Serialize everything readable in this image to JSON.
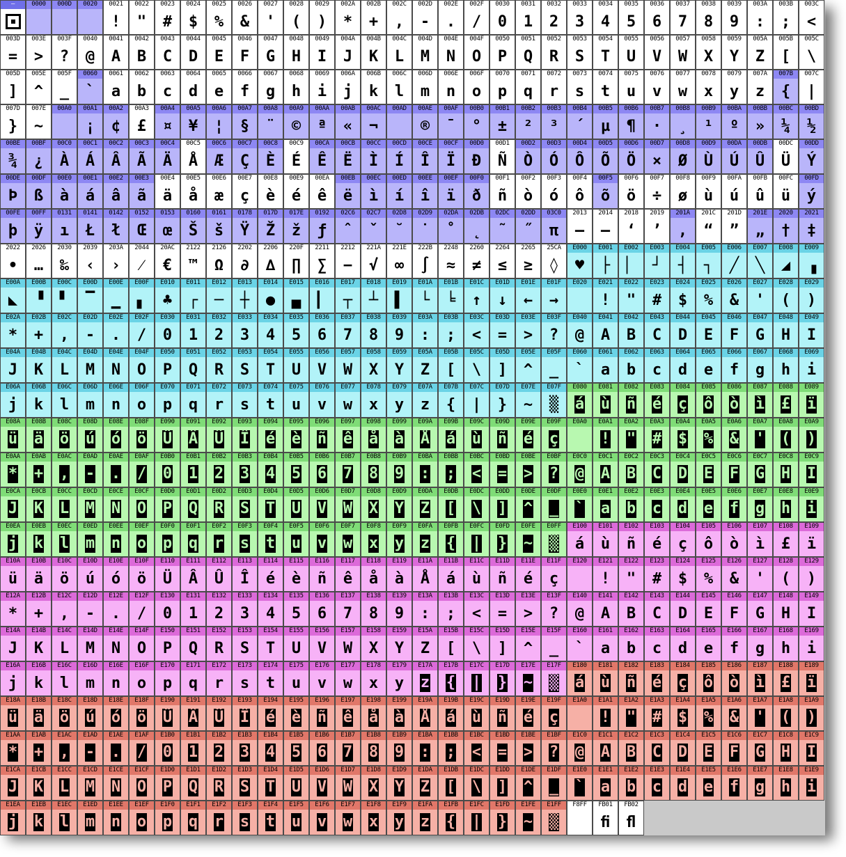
{
  "colors": {
    "basic": [
      "#ffffff",
      "#ffffff"
    ],
    "latin": [
      "#b9b5fa",
      "#8d87f3"
    ],
    "cyan": [
      "#b2f3f8",
      "#6ad3e6"
    ],
    "green": [
      "#b8f8b0",
      "#7fdc77"
    ],
    "magenta": [
      "#f7b2f7",
      "#dc6ad9"
    ],
    "salmon": [
      "#f6b0a6",
      "#e17769"
    ],
    "special_white": [
      "#ffffff",
      "#ffffff"
    ]
  },
  "codes": [
    "—",
    "0000",
    "000D",
    "0020",
    "0021",
    "0022",
    "0023",
    "0024",
    "0025",
    "0026",
    "0027",
    "0028",
    "0029",
    "002A",
    "002B",
    "002C",
    "002D",
    "002E",
    "002F",
    "0030",
    "0031",
    "0032",
    "0033",
    "0034",
    "0035",
    "0036",
    "0037",
    "0038",
    "0039",
    "003A",
    "003B",
    "003C",
    "003D",
    "003E",
    "003F",
    "0040",
    "0041",
    "0042",
    "0043",
    "0044",
    "0045",
    "0046",
    "0047",
    "0048",
    "0049",
    "004A",
    "004B",
    "004C",
    "004D",
    "004E",
    "004F",
    "0050",
    "0051",
    "0052",
    "0053",
    "0054",
    "0055",
    "0056",
    "0057",
    "0058",
    "0059",
    "005A",
    "005B",
    "005C",
    "005D",
    "005E",
    "005F",
    "0060",
    "0061",
    "0062",
    "0063",
    "0064",
    "0065",
    "0066",
    "0067",
    "0068",
    "0069",
    "006A",
    "006B",
    "006C",
    "006D",
    "006E",
    "006F",
    "0070",
    "0071",
    "0072",
    "0073",
    "0074",
    "0075",
    "0076",
    "0077",
    "0078",
    "0079",
    "007A",
    "007B",
    "007C",
    "007D",
    "007E",
    "00A0",
    "00A1",
    "00A2",
    "00A3",
    "00A4",
    "00A5",
    "00A6",
    "00A7",
    "00A8",
    "00A9",
    "00AA",
    "00AB",
    "00AC",
    "00AD",
    "00AE",
    "00AF",
    "00B0",
    "00B1",
    "00B2",
    "00B3",
    "00B4",
    "00B5",
    "00B6",
    "00B7",
    "00B8",
    "00B9",
    "00BA",
    "00BB",
    "00BC",
    "00BD",
    "00BE",
    "00BF",
    "00C0",
    "00C1",
    "00C2",
    "00C3",
    "00C4",
    "00C5",
    "00C6",
    "00C7",
    "00C8",
    "00C9",
    "00CA",
    "00CB",
    "00CC",
    "00CD",
    "00CE",
    "00CF",
    "00D0",
    "00D1",
    "00D2",
    "00D3",
    "00D4",
    "00D5",
    "00D6",
    "00D7",
    "00D8",
    "00D9",
    "00DA",
    "00DB",
    "00DC",
    "00DD",
    "00DE",
    "00DF",
    "00E0",
    "00E1",
    "00E2",
    "00E3",
    "00E4",
    "00E5",
    "00E6",
    "00E7",
    "00E8",
    "00E9",
    "00EA",
    "00EB",
    "00EC",
    "00ED",
    "00EE",
    "00EF",
    "00F0",
    "00F1",
    "00F2",
    "00F3",
    "00F4",
    "00F5",
    "00F6",
    "00F7",
    "00F8",
    "00F9",
    "00FA",
    "00FB",
    "00FC",
    "00FD",
    "00FE",
    "00FF",
    "0131",
    "0141",
    "0142",
    "0152",
    "0153",
    "0160",
    "0161",
    "0178",
    "017D",
    "017E",
    "0192",
    "02C6",
    "02C7",
    "02D8",
    "02D9",
    "02DA",
    "02DB",
    "02DC",
    "02DD",
    "03C0",
    "2013",
    "2014",
    "2018",
    "2019",
    "201A",
    "201C",
    "201D",
    "201E",
    "2020",
    "2021",
    "2022",
    "2026",
    "2030",
    "2039",
    "203A",
    "2044",
    "20AC",
    "2122",
    "2126",
    "2202",
    "2206",
    "220F",
    "2211",
    "2212",
    "221A",
    "221E",
    "222B",
    "2248",
    "2260",
    "2264",
    "2265",
    "25CA",
    "E000",
    "E001",
    "E002",
    "E003",
    "E004",
    "E005",
    "E006",
    "E007",
    "E008",
    "E009",
    "E00A",
    "E00B",
    "E00C",
    "E00D",
    "E00E",
    "E00F",
    "E010",
    "E011",
    "E012",
    "E013",
    "E014",
    "E015",
    "E016",
    "E017",
    "E018",
    "E019",
    "E01A",
    "E01B",
    "E01C",
    "E01D",
    "E01E",
    "E01F",
    "E020",
    "E021",
    "E022",
    "E023",
    "E024",
    "E025",
    "E026",
    "E027",
    "E028",
    "E029",
    "E02A",
    "E02B",
    "E02C",
    "E02D",
    "E02E",
    "E02F",
    "E030",
    "E031",
    "E032",
    "E033",
    "E034",
    "E035",
    "E036",
    "E037",
    "E038",
    "E039",
    "E03A",
    "E03B",
    "E03C",
    "E03D",
    "E03E",
    "E03F",
    "E040",
    "E041",
    "E042",
    "E043",
    "E044",
    "E045",
    "E046",
    "E047",
    "E048",
    "E049",
    "E04A",
    "E04B",
    "E04C",
    "E04D",
    "E04E",
    "E04F",
    "E050",
    "E051",
    "E052",
    "E053",
    "E054",
    "E055",
    "E056",
    "E057",
    "E058",
    "E059",
    "E05A",
    "E05B",
    "E05C",
    "E05D",
    "E05E",
    "E05F",
    "E060",
    "E061",
    "E062",
    "E063",
    "E064",
    "E065",
    "E066",
    "E067",
    "E068",
    "E069",
    "E06A",
    "E06B",
    "E06C",
    "E06D",
    "E06E",
    "E06F",
    "E070",
    "E071",
    "E072",
    "E073",
    "E074",
    "E075",
    "E076",
    "E077",
    "E078",
    "E079",
    "E07A",
    "E07B",
    "E07C",
    "E07D",
    "E07E",
    "E07F",
    "E080",
    "E081",
    "E082",
    "E083",
    "E084",
    "E085",
    "E086",
    "E087",
    "E088",
    "E089",
    "E08A",
    "E08B",
    "E08C",
    "E08D",
    "E08E",
    "E08F",
    "E090",
    "E091",
    "E092",
    "E093",
    "E094",
    "E095",
    "E096",
    "E097",
    "E098",
    "E099",
    "E09A",
    "E09B",
    "E09C",
    "E09D",
    "E09E",
    "E09F",
    "E0A0",
    "E0A1",
    "E0A2",
    "E0A3",
    "E0A4",
    "E0A5",
    "E0A6",
    "E0A7",
    "E0A8",
    "E0A9",
    "E0AA",
    "E0AB",
    "E0AC",
    "E0AD",
    "E0AE",
    "E0AF",
    "E0B0",
    "E0B1",
    "E0B2",
    "E0B3",
    "E0B4",
    "E0B5",
    "E0B6",
    "E0B7",
    "E0B8",
    "E0B9",
    "E0BA",
    "E0BB",
    "E0BC",
    "E0BD",
    "E0BE",
    "E0BF",
    "E0C0",
    "E0C1",
    "E0C2",
    "E0C3",
    "E0C4",
    "E0C5",
    "E0C6",
    "E0C7",
    "E0C8",
    "E0C9",
    "E0CA",
    "E0CB",
    "E0CC",
    "E0CD",
    "E0CE",
    "E0CF",
    "E0D0",
    "E0D1",
    "E0D2",
    "E0D3",
    "E0D4",
    "E0D5",
    "E0D6",
    "E0D7",
    "E0D8",
    "E0D9",
    "E0DA",
    "E0DB",
    "E0DC",
    "E0DD",
    "E0DE",
    "E0DF",
    "E0E0",
    "E0E1",
    "E0E2",
    "E0E3",
    "E0E4",
    "E0E5",
    "E0E6",
    "E0E7",
    "E0E8",
    "E0E9",
    "E0EA",
    "E0EB",
    "E0EC",
    "E0ED",
    "E0EE",
    "E0EF",
    "E0F0",
    "E0F1",
    "E0F2",
    "E0F3",
    "E0F4",
    "E0F5",
    "E0F6",
    "E0F7",
    "E0F8",
    "E0F9",
    "E0FA",
    "E0FB",
    "E0FC",
    "E0FD",
    "E0FE",
    "E0FF",
    "E100",
    "E101",
    "E102",
    "E103",
    "E104",
    "E105",
    "E106",
    "E107",
    "E108",
    "E109",
    "E10A",
    "E10B",
    "E10C",
    "E10D",
    "E10E",
    "E10F",
    "E110",
    "E111",
    "E112",
    "E113",
    "E114",
    "E115",
    "E116",
    "E117",
    "E118",
    "E119",
    "E11A",
    "E11B",
    "E11C",
    "E11D",
    "E11E",
    "E11F",
    "E120",
    "E121",
    "E122",
    "E123",
    "E124",
    "E125",
    "E126",
    "E127",
    "E128",
    "E129",
    "E12A",
    "E12B",
    "E12C",
    "E12D",
    "E12E",
    "E12F",
    "E130",
    "E131",
    "E132",
    "E133",
    "E134",
    "E135",
    "E136",
    "E137",
    "E138",
    "E139",
    "E13A",
    "E13B",
    "E13C",
    "E13D",
    "E13E",
    "E13F",
    "E140",
    "E141",
    "E142",
    "E143",
    "E144",
    "E145",
    "E146",
    "E147",
    "E148",
    "E149",
    "E14A",
    "E14B",
    "E14C",
    "E14D",
    "E14E",
    "E14F",
    "E150",
    "E151",
    "E152",
    "E153",
    "E154",
    "E155",
    "E156",
    "E157",
    "E158",
    "E159",
    "E15A",
    "E15B",
    "E15C",
    "E15D",
    "E15E",
    "E15F",
    "E160",
    "E161",
    "E162",
    "E163",
    "E164",
    "E165",
    "E166",
    "E167",
    "E168",
    "E169",
    "E16A",
    "E16B",
    "E16C",
    "E16D",
    "E16E",
    "E16F",
    "E170",
    "E171",
    "E172",
    "E173",
    "E174",
    "E175",
    "E176",
    "E177",
    "E178",
    "E179",
    "E17A",
    "E17B",
    "E17C",
    "E17D",
    "E17E",
    "E17F",
    "E180",
    "E181",
    "E182",
    "E183",
    "E184",
    "E185",
    "E186",
    "E187",
    "E188",
    "E189",
    "E18A",
    "E18B",
    "E18C",
    "E18D",
    "E18E",
    "E18F",
    "E190",
    "E191",
    "E192",
    "E193",
    "E194",
    "E195",
    "E196",
    "E197",
    "E198",
    "E199",
    "E19A",
    "E19B",
    "E19C",
    "E19D",
    "E19E",
    "E19F",
    "E1A0",
    "E1A1",
    "E1A2",
    "E1A3",
    "E1A4",
    "E1A5",
    "E1A6",
    "E1A7",
    "E1A8",
    "E1A9",
    "E1AA",
    "E1AB",
    "E1AC",
    "E1AD",
    "E1AE",
    "E1AF",
    "E1B0",
    "E1B1",
    "E1B2",
    "E1B3",
    "E1B4",
    "E1B5",
    "E1B6",
    "E1B7",
    "E1B8",
    "E1B9",
    "E1BA",
    "E1BB",
    "E1BC",
    "E1BD",
    "E1BE",
    "E1BF",
    "E1C0",
    "E1C1",
    "E1C2",
    "E1C3",
    "E1C4",
    "E1C5",
    "E1C6",
    "E1C7",
    "E1C8",
    "E1C9",
    "E1CA",
    "E1CB",
    "E1CC",
    "E1CD",
    "E1CE",
    "E1CF",
    "E1D0",
    "E1D1",
    "E1D2",
    "E1D3",
    "E1D4",
    "E1D5",
    "E1D6",
    "E1D7",
    "E1D8",
    "E1D9",
    "E1DA",
    "E1DB",
    "E1DC",
    "E1DD",
    "E1DE",
    "E1DF",
    "E1E0",
    "E1E1",
    "E1E2",
    "E1E3",
    "E1E4",
    "E1E5",
    "E1E6",
    "E1E7",
    "E1E8",
    "E1E9",
    "E1EA",
    "E1EB",
    "E1EC",
    "E1ED",
    "E1EE",
    "E1EF",
    "E1F0",
    "E1F1",
    "E1F2",
    "E1F3",
    "E1F4",
    "E1F5",
    "E1F6",
    "E1F7",
    "E1F8",
    "E1F9",
    "E1FA",
    "E1FB",
    "E1FC",
    "E1FD",
    "E1FE",
    "E1FF",
    "F8FF",
    "FB01",
    "FB02"
  ],
  "glyphs": {
    "ascii": "!\"#$%&'()*+,-./0123456789:;<=>?@ABCDEFGHIJKLMNOPQRSTUVWXYZ[\\]^_`abcdefghijklmnopqrstuvwxyz{|}~",
    "latin1": [
      " ",
      "¡",
      "¢",
      "£",
      "¤",
      "¥",
      "¦",
      "§",
      "¨",
      "©",
      "ª",
      "«",
      "¬",
      "-",
      "®",
      "¯",
      "°",
      "±",
      "²",
      "³",
      "´",
      "µ",
      "¶",
      "·",
      "¸",
      "¹",
      "º",
      "»",
      "¼",
      "½",
      "¾",
      "¿",
      "À",
      "Á",
      "Â",
      "Ã",
      "Ä",
      "Å",
      "Æ",
      "Ç",
      "È",
      "É",
      "Ê",
      "Ë",
      "Ì",
      "Í",
      "Î",
      "Ï",
      "Ð",
      "Ñ",
      "Ò",
      "Ó",
      "Ô",
      "Õ",
      "Ö",
      "×",
      "Ø",
      "Ù",
      "Ú",
      "Û",
      "Ü",
      "Ý",
      "Þ",
      "ß",
      "à",
      "á",
      "â",
      "ã",
      "ä",
      "å",
      "æ",
      "ç",
      "è",
      "é",
      "ê",
      "ë",
      "ì",
      "í",
      "î",
      "ï",
      "ð",
      "ñ",
      "ò",
      "ó",
      "ô",
      "õ",
      "ö",
      "÷",
      "ø",
      "ù",
      "ú",
      "û",
      "ü",
      "ý",
      "þ",
      "ÿ"
    ],
    "ext": [
      "ı",
      "Ł",
      "ł",
      "Œ",
      "œ",
      "Š",
      "š",
      "Ÿ",
      "Ž",
      "ž",
      "ƒ",
      "ˆ",
      "ˇ",
      "˘",
      "˙",
      "˚",
      "˛",
      "˜",
      "˝",
      "π",
      "–",
      "—",
      "‘",
      "’",
      "‚",
      "“",
      "”",
      "„",
      "†",
      "‡",
      "•",
      "…",
      "‰",
      "‹",
      "›",
      "⁄",
      "€",
      "™",
      "Ω",
      "∂",
      "∆",
      "∏",
      "∑",
      "−",
      "√",
      "∞",
      "∫",
      "≈",
      "≠",
      "≤",
      "≥",
      "◊"
    ],
    "gfx1": [
      "♥",
      "├",
      "▏",
      "┘",
      "┤",
      "┐",
      "╱",
      "╲",
      "◢",
      "▗",
      "◣",
      "▝",
      "▘",
      "▔",
      "▁",
      "▖",
      "♣",
      "┌",
      "─",
      "┼",
      "●",
      "▄",
      "▎",
      "┬",
      "┴",
      "▌",
      "└",
      "╘",
      "↑",
      "↓",
      "←",
      "→"
    ],
    "apple": "",
    "fi": "ﬁ",
    "fl": "ﬂ",
    "accent_lower": [
      "á",
      "ù",
      "ñ",
      "é",
      "ç",
      "ô",
      "ò",
      "ì",
      "£",
      "ï",
      "ü",
      "ä",
      "ö",
      "ú",
      "ó",
      "ö",
      "Ü",
      "Â",
      "Û",
      "Î",
      "é",
      "è",
      "ñ",
      "ê",
      "å",
      "à",
      "Å"
    ],
    "inverse_extra": [
      "▒",
      "▌",
      "▐",
      "▖",
      "▝",
      "♠",
      "│",
      "▙",
      "◀",
      "▶"
    ]
  }
}
